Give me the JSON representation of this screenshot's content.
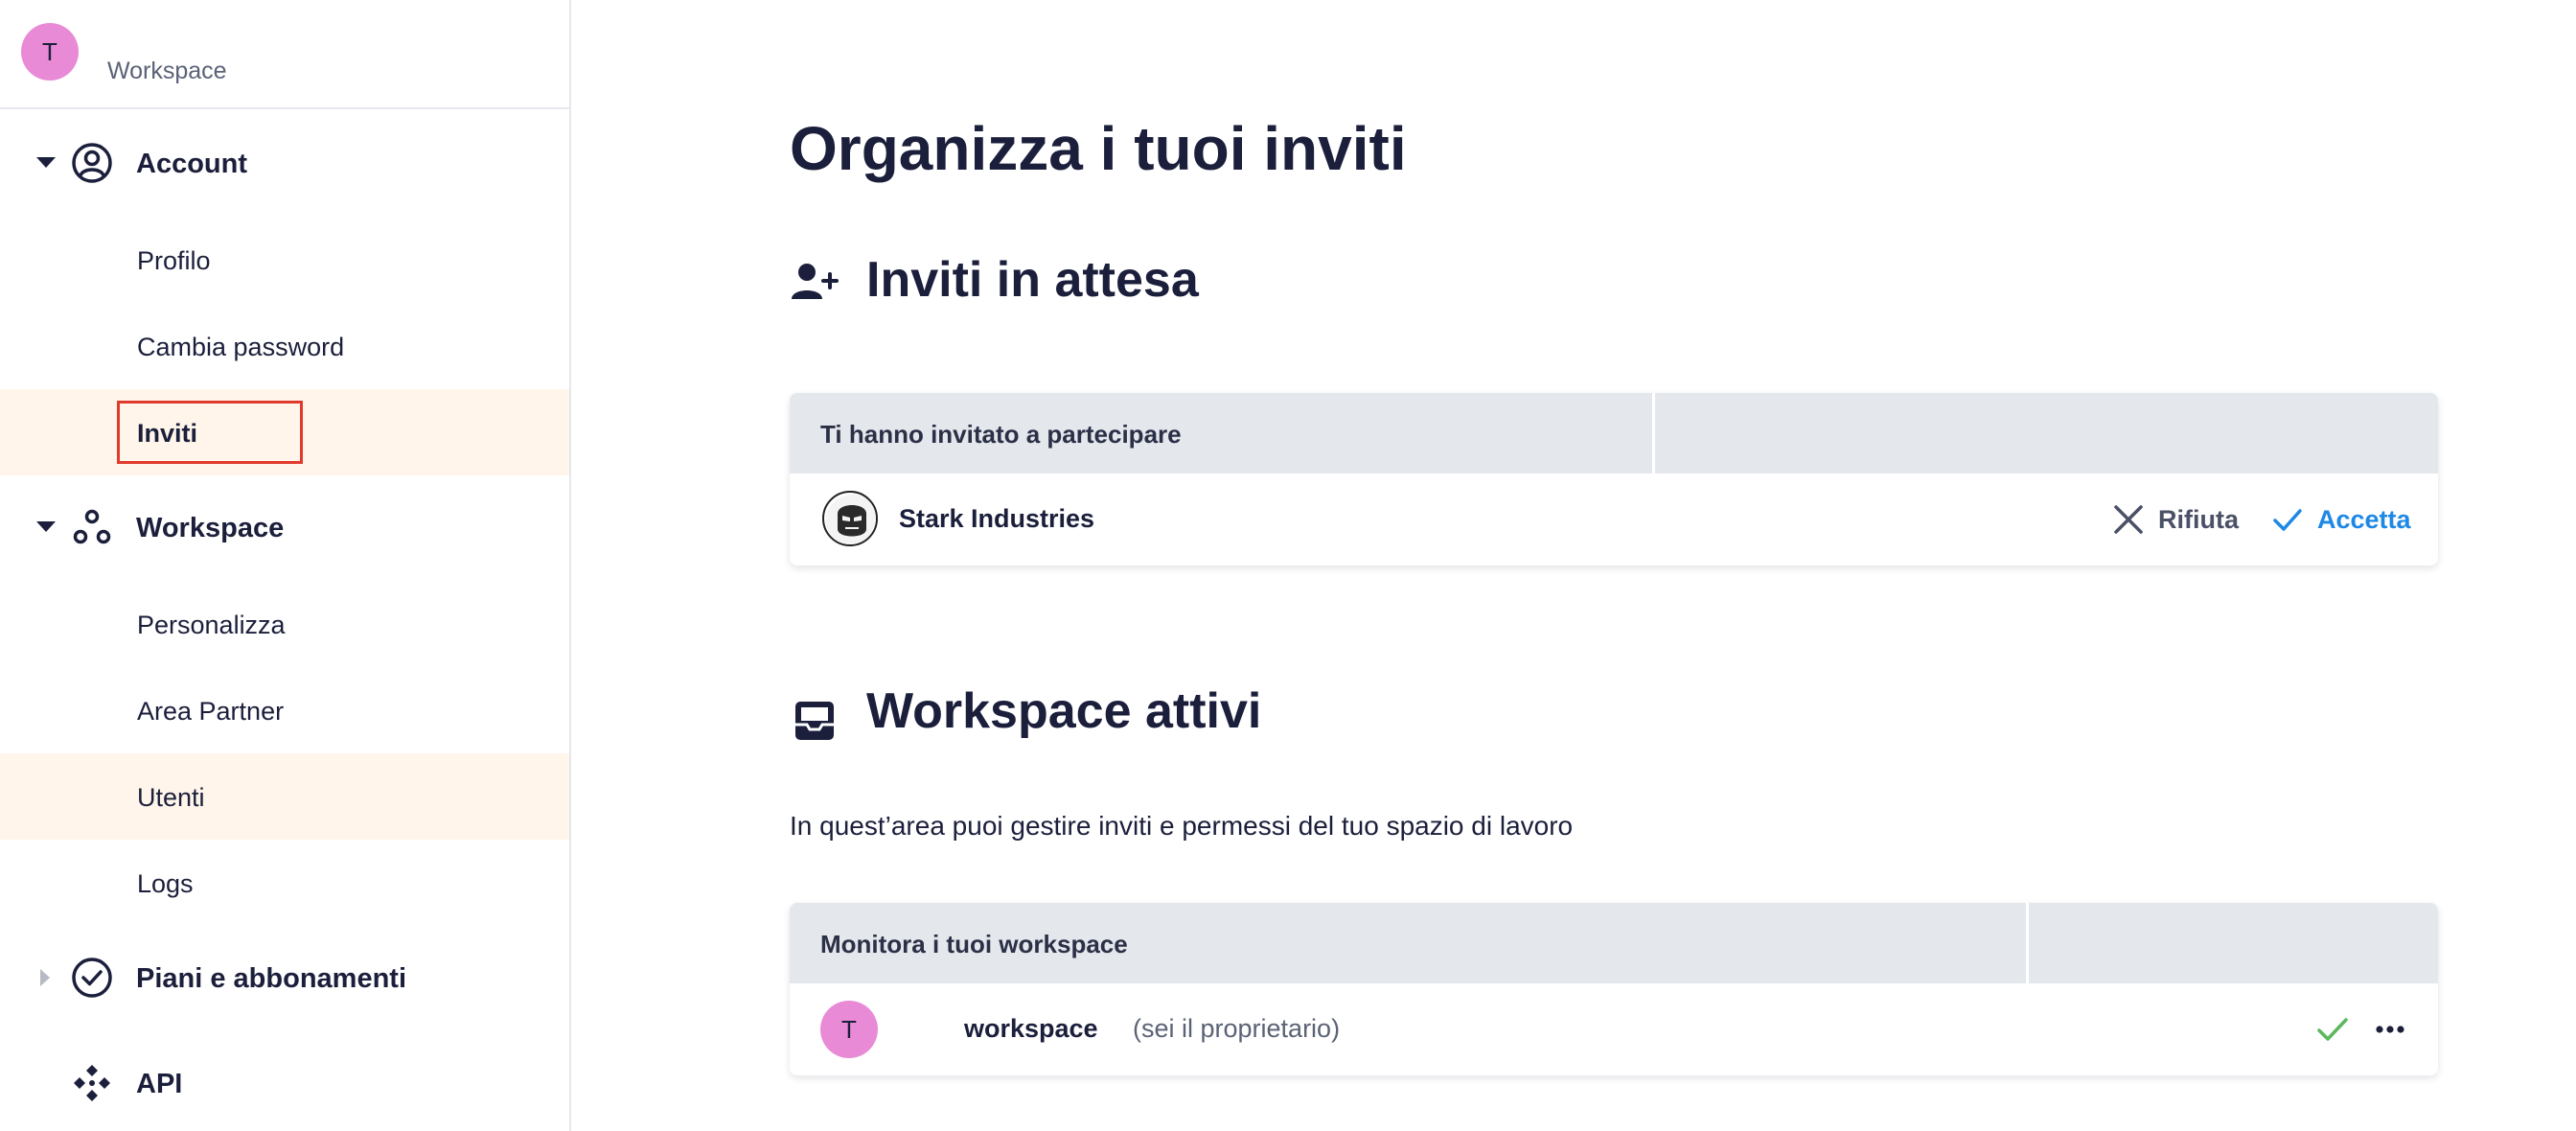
{
  "sidebar": {
    "workspace_avatar": "T",
    "workspace_name": "Workspace",
    "groups": {
      "account": {
        "label": "Account",
        "icon": "user-circle-icon"
      },
      "workspace": {
        "label": "Workspace",
        "icon": "nodes-icon"
      },
      "plans": {
        "label": "Piani e abbonamenti",
        "icon": "check-circle-icon"
      },
      "api": {
        "label": "API",
        "icon": "api-diamond-icon"
      }
    },
    "account_items": [
      "Profilo",
      "Cambia password",
      "Inviti"
    ],
    "workspace_items": [
      "Personalizza",
      "Area Partner",
      "Utenti",
      "Logs"
    ],
    "active_item": "Inviti"
  },
  "main": {
    "title": "Organizza i tuoi inviti",
    "pending": {
      "title": "Inviti in attesa",
      "icon": "user-plus-icon",
      "table_header": "Ti hanno invitato a partecipare",
      "invite": {
        "org_name": "Stark Industries",
        "reject_label": "Rifiuta",
        "accept_label": "Accetta"
      }
    },
    "active": {
      "title": "Workspace attivi",
      "icon": "inbox-icon",
      "description": "In quest’area puoi gestire inviti e permessi del tuo spazio di lavoro",
      "table_header": "Monitora i tuoi workspace",
      "row": {
        "avatar": "T",
        "name": "workspace",
        "owner_note": "(sei il proprietario)"
      }
    }
  },
  "colors": {
    "accent": "#1e88e5",
    "avatar": "#e98ad6",
    "selected_bg": "#fff5ea",
    "highlight_border": "#e03a2c",
    "success": "#5cb85c"
  }
}
